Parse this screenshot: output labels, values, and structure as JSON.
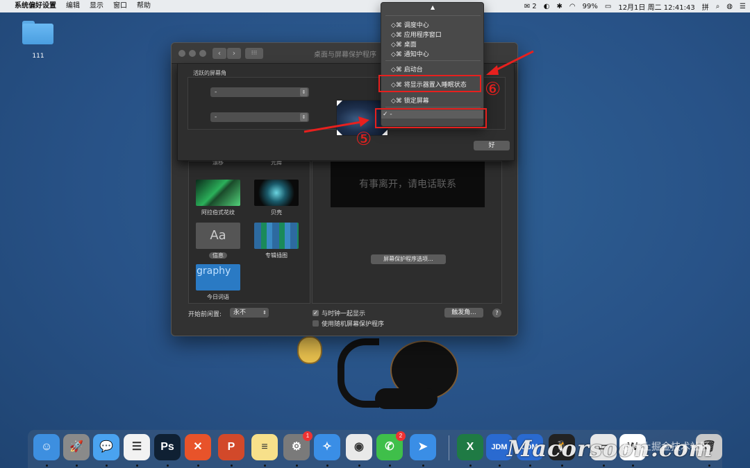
{
  "menubar": {
    "apple": "",
    "app_name": "系统偏好设置",
    "menus": [
      "编辑",
      "显示",
      "窗口",
      "帮助"
    ],
    "status": {
      "notif_count": "2",
      "battery": "99%",
      "datetime": "12月1日 周二  12:41:43",
      "input_method": "拼"
    }
  },
  "desktop": {
    "folder_label": "111"
  },
  "window": {
    "title": "桌面与屏幕保护程序",
    "back": "‹",
    "forward": "›",
    "grid": "⁝⁝⁝"
  },
  "sheet": {
    "label": "活跃的屏幕角",
    "corner_top_left": "-",
    "corner_bottom_left": "-",
    "ok_label": "好"
  },
  "savers": [
    {
      "label": "漂移",
      "color": "#1a2a4a"
    },
    {
      "label": "光舞",
      "color": "#1a2a4a"
    },
    {
      "label": "阿拉伯式花纹",
      "color": "#1e6b3a"
    },
    {
      "label": "贝壳",
      "color": "#1a5a6a"
    },
    {
      "label": "信息",
      "color": "#5a5a5a",
      "glyph": "Aa",
      "selected": true
    },
    {
      "label": "专辑插图",
      "color": "#2d6aa0"
    },
    {
      "label": "今日词语",
      "color": "#2a7ac4",
      "glyph": "graphy"
    }
  ],
  "preview": {
    "text": "有事离开，请电话联系",
    "options_button": "屏幕保护程序选项..."
  },
  "bottom": {
    "start_label": "开始前闲置:",
    "start_value": "永不",
    "show_clock": "与时钟一起显示",
    "show_clock_checked": true,
    "random": "使用随机屏幕保护程序",
    "random_checked": false,
    "hot_corners": "触发角...",
    "help": "?"
  },
  "menu": {
    "caret": "▲",
    "items_group1": [
      "◇⌘ 调度中心",
      "◇⌘ 应用程序窗口",
      "◇⌘ 桌面",
      "◇⌘ 通知中心"
    ],
    "launchpad": "◇⌘ 启动台",
    "sleep_display": "◇⌘ 将显示器置入睡眠状态",
    "lock_screen": "◇⌘ 锁定屏幕",
    "selected": "✓ -"
  },
  "annotations": {
    "five": "⑤",
    "six": "⑥",
    "accent": "#e7201e"
  },
  "dock": [
    {
      "name": "finder",
      "text": "☺",
      "color": "#3d8fe0"
    },
    {
      "name": "launchpad",
      "text": "🚀",
      "color": "#8a8a8a"
    },
    {
      "name": "messages",
      "text": "💬",
      "color": "#4aa3f0"
    },
    {
      "name": "reminders",
      "text": "☰",
      "color": "#f2f2f2"
    },
    {
      "name": "photoshop",
      "text": "Ps",
      "color": "#0f2033"
    },
    {
      "name": "xmind",
      "text": "✕",
      "color": "#e8532a"
    },
    {
      "name": "powerpoint",
      "text": "P",
      "color": "#d2492a"
    },
    {
      "name": "notes",
      "text": "≡",
      "color": "#f7e08a"
    },
    {
      "name": "system-preferences",
      "text": "⚙",
      "color": "#7a7a7a",
      "badge": "1"
    },
    {
      "name": "safari",
      "text": "✧",
      "color": "#3a8ee6"
    },
    {
      "name": "chrome",
      "text": "◉",
      "color": "#e9e9e9"
    },
    {
      "name": "wechat",
      "text": "✆",
      "color": "#3fbf4a",
      "badge": "2"
    },
    {
      "name": "dingtalk",
      "text": "➤",
      "color": "#3a8ee6"
    },
    {
      "name": "excel",
      "text": "X",
      "color": "#1f7a44"
    },
    {
      "name": "jdm1",
      "text": "JDM",
      "color": "#2a6ad0"
    },
    {
      "name": "jdm2",
      "text": "JDM",
      "color": "#2a6ad0"
    },
    {
      "name": "qq",
      "text": "🐧",
      "color": "#222"
    },
    {
      "name": "preview-doc",
      "text": "▭",
      "color": "#e8e8e8"
    },
    {
      "name": "word-doc",
      "text": "W",
      "color": "#ffffff"
    },
    {
      "name": "trash",
      "text": "🗑",
      "color": "#c9c9c9"
    }
  ],
  "watermark": {
    "main": "Macorsoon.com",
    "sub": "@稀土掘金技术社区"
  }
}
